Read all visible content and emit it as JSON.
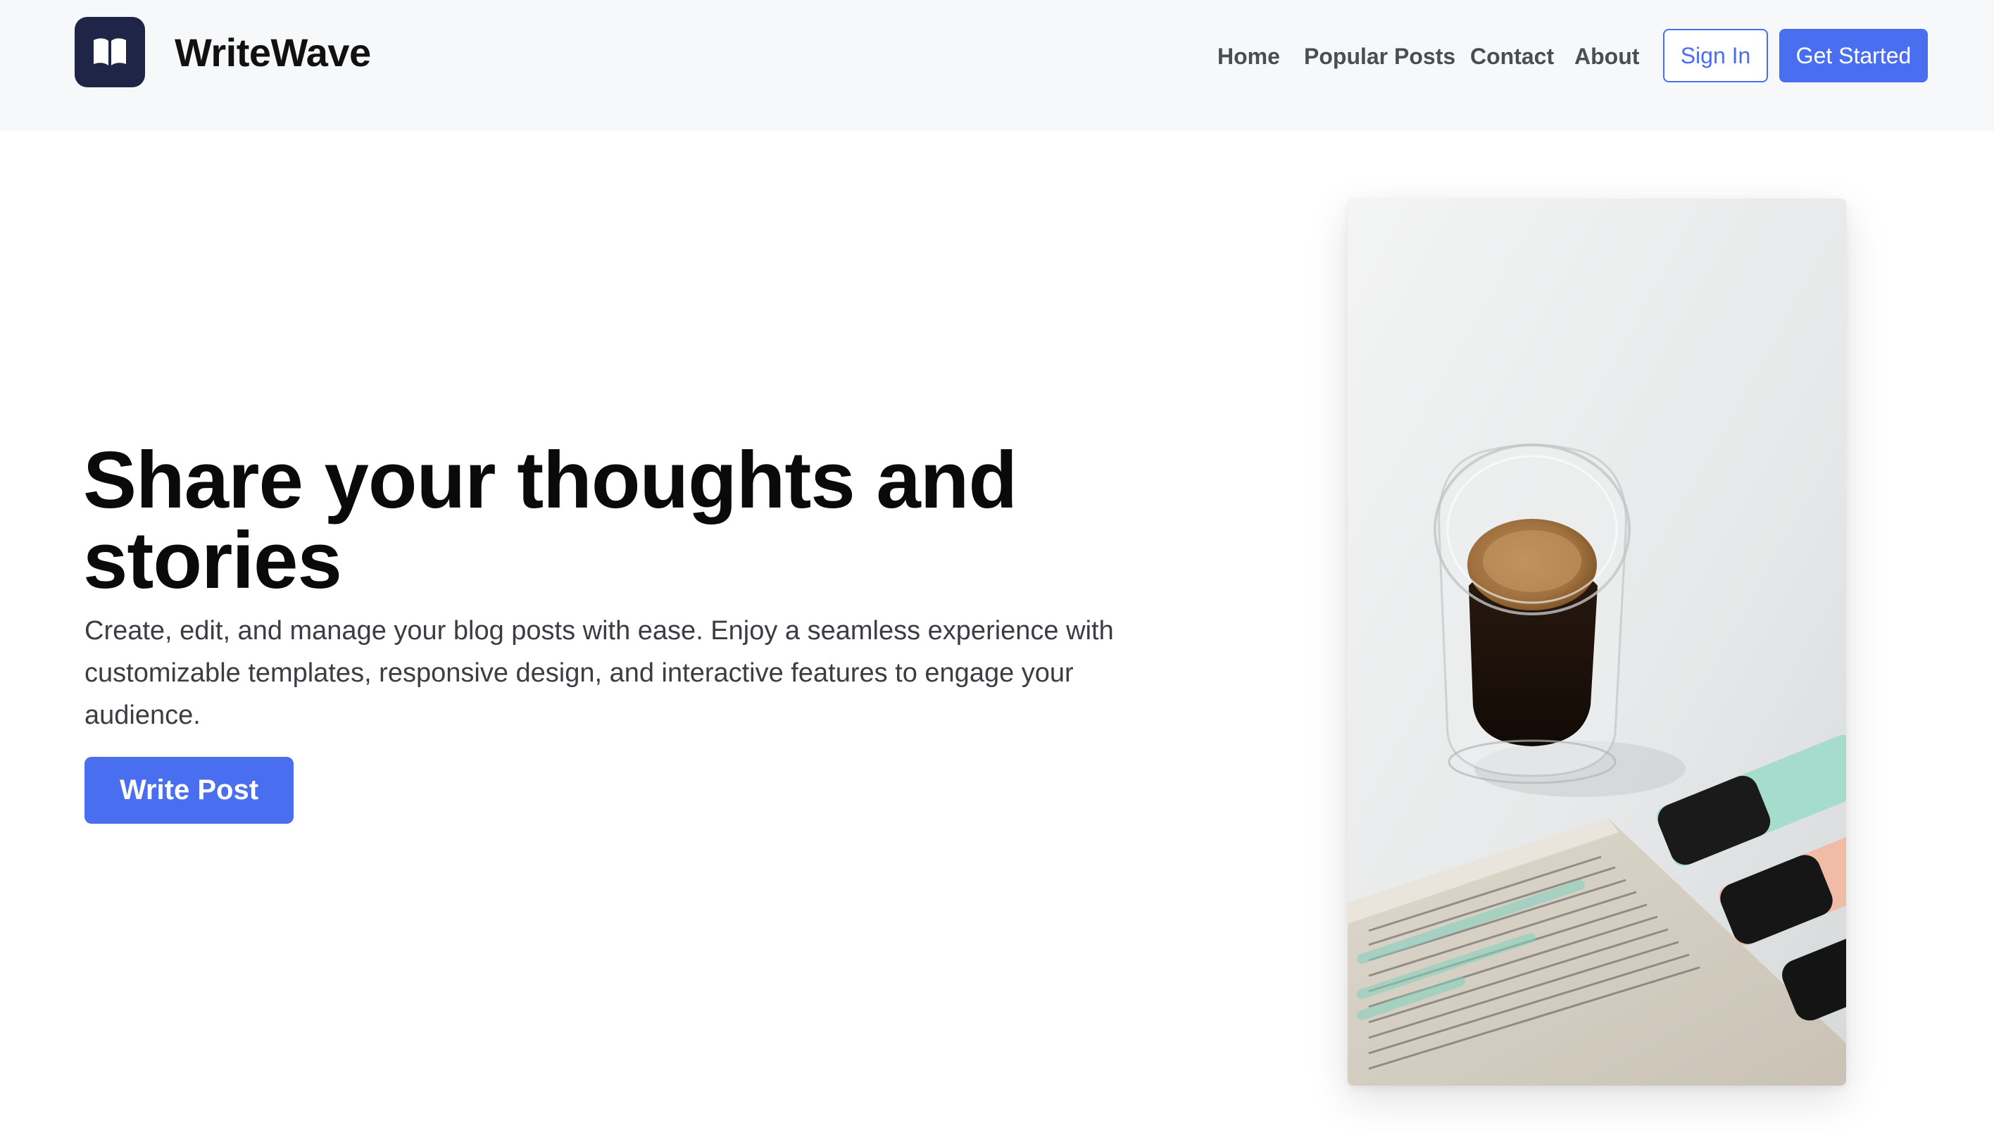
{
  "header": {
    "brand": "WriteWave",
    "nav": [
      "Home",
      "Popular Posts",
      "Contact",
      "About"
    ],
    "sign_in_label": "Sign In",
    "get_started_label": "Get Started"
  },
  "hero": {
    "title": "Share your thoughts and stories",
    "description": "Create, edit, and manage your blog posts with ease. Enjoy a seamless experience with customizable templates, responsive design, and interactive features to engage your audience.",
    "cta_label": "Write Post"
  },
  "icons": {
    "logo": "open-book-icon"
  },
  "colors": {
    "accent": "#4a6ef0",
    "logo_bg": "#1f2547",
    "header_bg": "#f7f8f9"
  },
  "image": {
    "subject": "coffee-glass-book-highlighters-photo"
  }
}
